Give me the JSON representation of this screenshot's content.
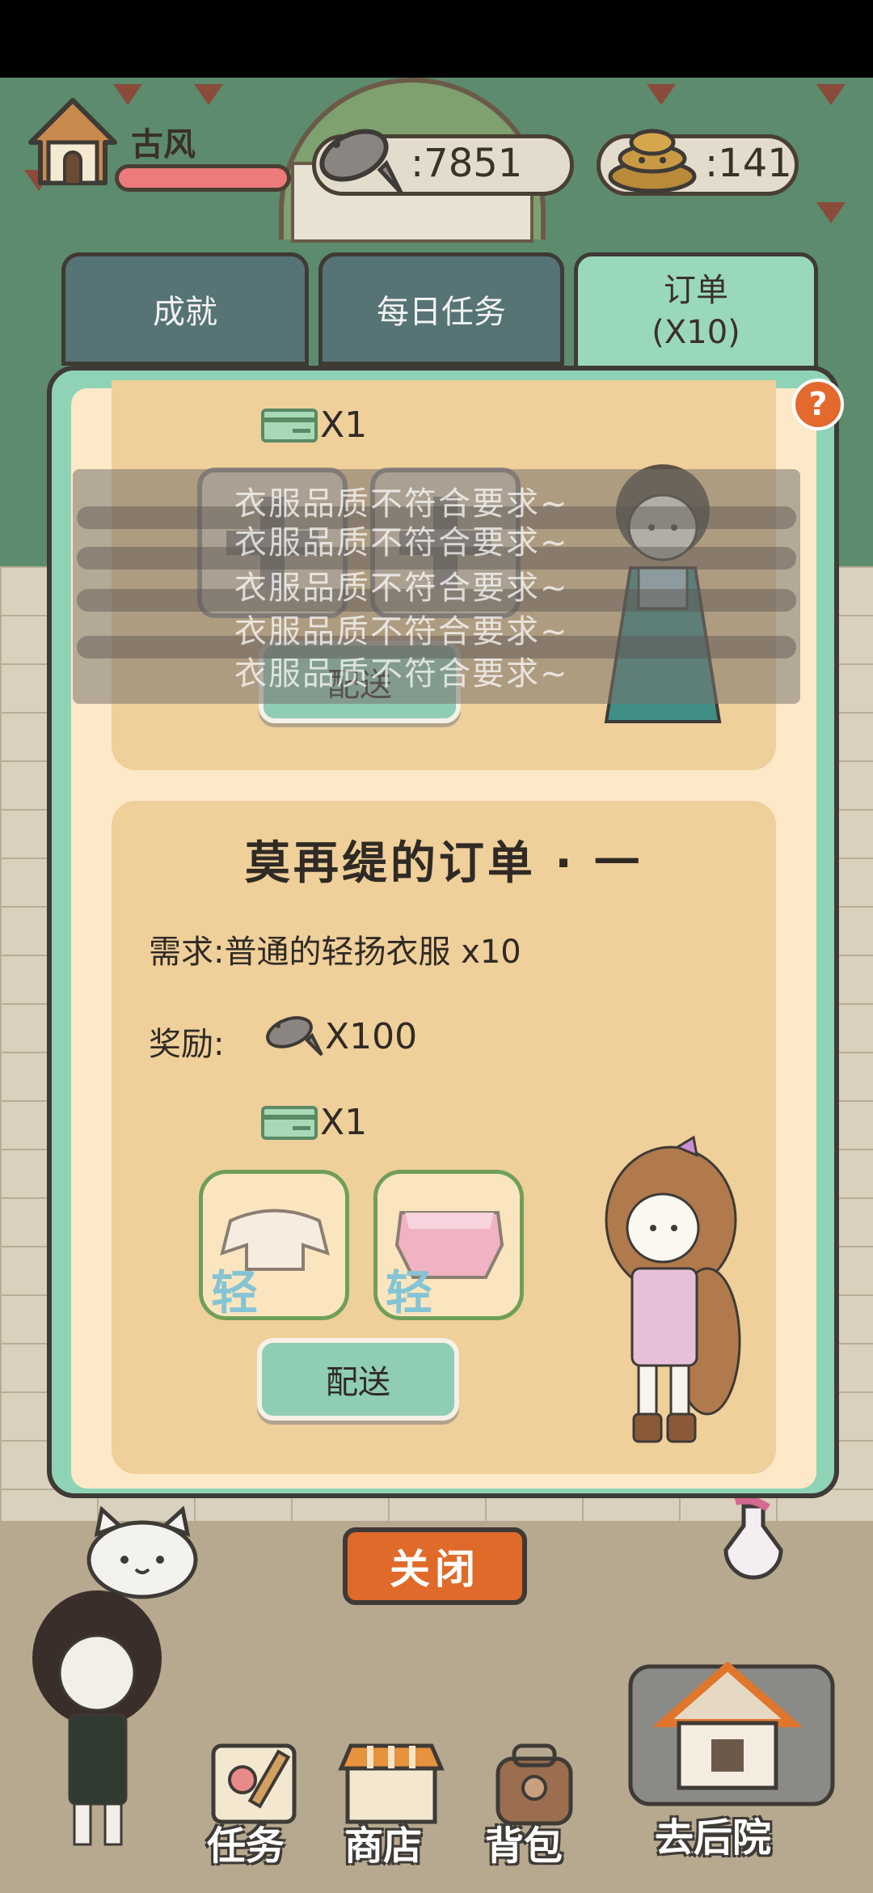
{
  "hud": {
    "player_name": "古风",
    "fish_count": "7851",
    "poop_count": "141",
    "fish_prefix": ":",
    "poop_prefix": ":"
  },
  "tabs": [
    {
      "label": "成就"
    },
    {
      "label": "每日任务"
    },
    {
      "label": "订单",
      "sub": "(X10)"
    }
  ],
  "help": {
    "label": "?"
  },
  "order_top": {
    "ticket_amount": "X1",
    "deliver_label": "配送"
  },
  "toast": {
    "messages": [
      "衣服品质不符合要求~",
      "衣服品质不符合要求~",
      "衣服品质不符合要求~",
      "衣服品质不符合要求~",
      "衣服品质不符合要求~"
    ]
  },
  "order_bottom": {
    "title": "莫再缇的订单 · 一",
    "demand": "需求:普通的轻扬衣服 x10",
    "reward_label": "奖励:",
    "reward_amount": "X100",
    "ticket_amount": "X1",
    "item_badge_1": "轻",
    "item_badge_2": "轻",
    "deliver_label": "配送"
  },
  "close_label": "关闭",
  "bottom_nav": [
    {
      "label": "任务"
    },
    {
      "label": "商店"
    },
    {
      "label": "背包"
    },
    {
      "label": "去后院"
    }
  ],
  "colors": {
    "panel": "#8fd3b6",
    "tab_inactive": "#567375",
    "close_button": "#e06a2a",
    "card": "#efcf9a"
  }
}
